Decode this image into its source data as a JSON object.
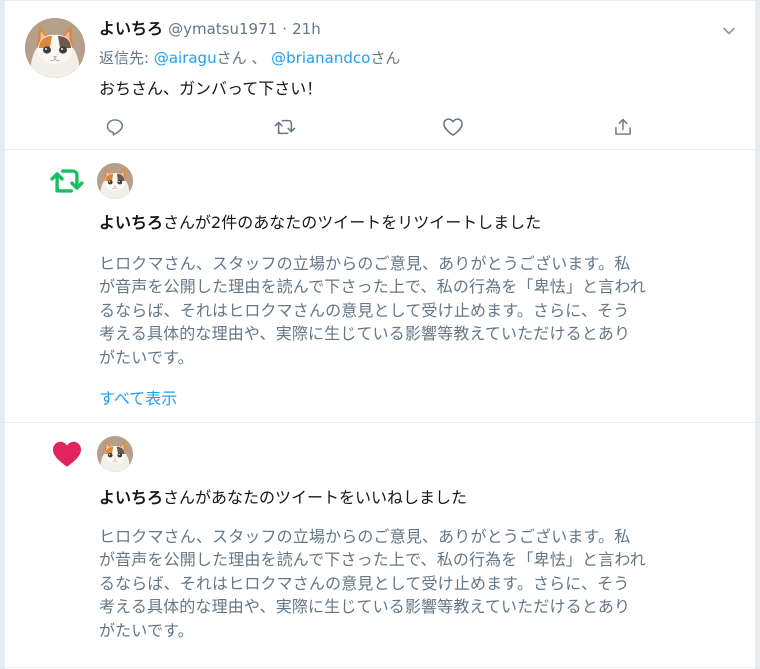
{
  "tweet": {
    "name": "よいちろ",
    "handle": "@ymatsu1971",
    "separator": "·",
    "time": "21h",
    "reply_prefix": "返信先: ",
    "reply_user1": "@airagu",
    "reply_suffix1": "さん 、 ",
    "reply_user2": "@brianandco",
    "reply_suffix2": "さん",
    "text": "おちさん、ガンバって下さい！",
    "icons": {
      "caret": "chevron-down-icon",
      "reply": "reply-icon",
      "retweet": "retweet-icon",
      "like": "heart-icon",
      "share": "share-icon"
    }
  },
  "notifications": [
    {
      "icon": "retweet-icon",
      "icon_color": "#17bf63",
      "user": "よいちろ",
      "action_text": "さんが2件のあなたのツイートをリツイートしました",
      "body_lines": [
        "ヒロクマさん、スタッフの立場からのご意見、ありがとうございます。私",
        "が音声を公開した理由を読んで下さった上で、私の行為を「卑怯」と言われ",
        "るならば、それはヒロクマさんの意見として受け止めます。さらに、そう",
        "考える具体的な理由や、実際に生じている影響等教えていただけるとあり",
        "がたいです。"
      ],
      "show_all": "すべて表示"
    },
    {
      "icon": "heart-icon",
      "icon_color": "#e0245e",
      "user": "よいちろ",
      "action_text": "さんがあなたのツイートをいいねしました",
      "body_lines": [
        "ヒロクマさん、スタッフの立場からのご意見、ありがとうございます。私",
        "が音声を公開した理由を読んで下さった上で、私の行為を「卑怯」と言われ",
        "るならば、それはヒロクマさんの意見として受け止めます。さらに、そう",
        "考える具体的な理由や、実際に生じている影響等教えていただけるとあり",
        "がたいです。"
      ]
    }
  ],
  "colors": {
    "link": "#1da1f2",
    "secondary_text": "#657786",
    "primary_text": "#14171a",
    "divider": "#e6ecf0"
  }
}
